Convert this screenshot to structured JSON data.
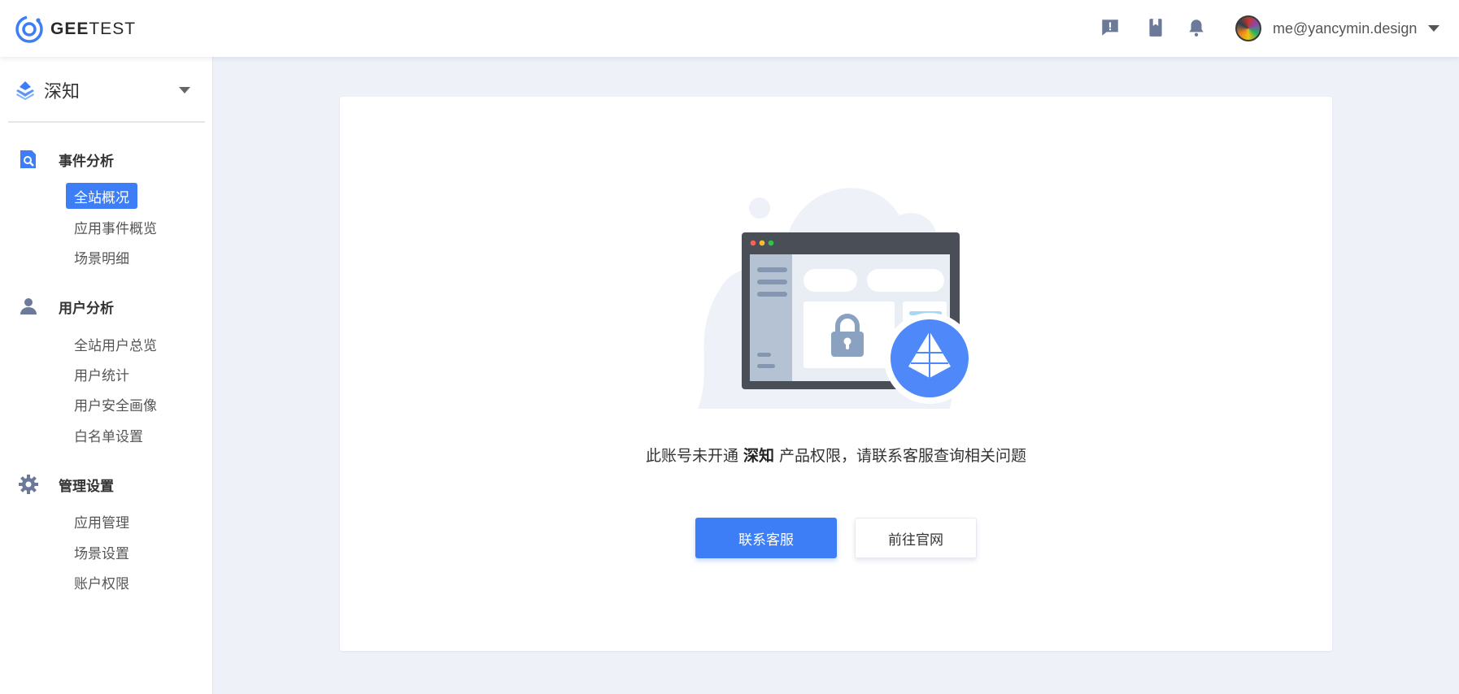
{
  "brand": {
    "logo_text_bold": "GEE",
    "logo_text_light": "TEST",
    "logo_icon": "geetest-logo-icon"
  },
  "header": {
    "icons": [
      "feedback-icon",
      "book-icon",
      "bell-icon"
    ],
    "user_email": "me@yancymin.design"
  },
  "sidebar": {
    "product": "深知",
    "groups": [
      {
        "title": "事件分析",
        "icon": "search-doc-icon",
        "items": [
          "全站概况",
          "应用事件概览",
          "场景明细"
        ]
      },
      {
        "title": "用户分析",
        "icon": "user-icon",
        "items": [
          "全站用户总览",
          "用户统计",
          "用户安全画像",
          "白名单设置"
        ]
      },
      {
        "title": "管理设置",
        "icon": "gear-icon",
        "items": [
          "应用管理",
          "场景设置",
          "账户权限"
        ]
      }
    ],
    "active_item": "全站概况"
  },
  "main": {
    "message_before": "此账号未开通 ",
    "message_product": "深知",
    "message_after": " 产品权限，请联系客服查询相关问题",
    "primary_button": "联系客服",
    "secondary_button": "前往官网"
  },
  "colors": {
    "accent": "#3d7ef7",
    "background": "#eef2f8",
    "sidebar_icon": "#6b7a99"
  }
}
